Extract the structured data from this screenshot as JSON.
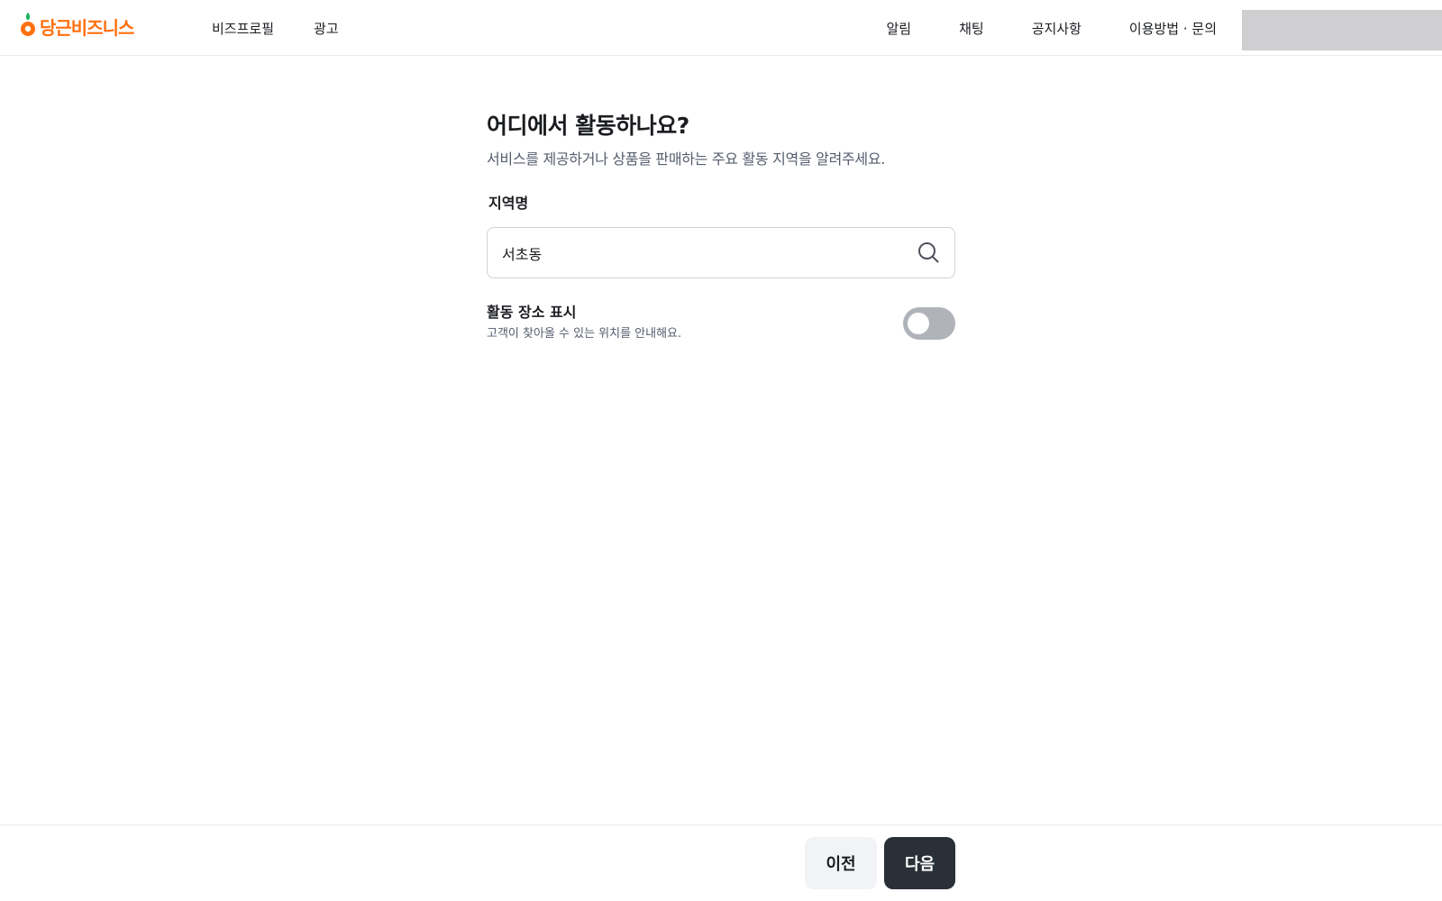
{
  "brand": {
    "name": "당근비즈니스",
    "color": "#ff6f0f",
    "icon": "carrot-icon"
  },
  "nav": {
    "left": [
      {
        "label": "비즈프로필"
      },
      {
        "label": "광고"
      }
    ],
    "right": [
      {
        "label": "알림"
      },
      {
        "label": "채팅"
      },
      {
        "label": "공지사항"
      },
      {
        "label": "이용방법 · 문의"
      }
    ]
  },
  "page": {
    "title": "어디에서 활동하나요?",
    "subtitle": "서비스를 제공하거나 상품을 판매하는 주요 활동 지역을 알려주세요."
  },
  "region": {
    "label": "지역명",
    "value": "서초동",
    "icon": "search-icon"
  },
  "location_toggle": {
    "title": "활동 장소 표시",
    "description": "고객이 찾아올 수 있는 위치를 안내해요.",
    "enabled": false
  },
  "footer": {
    "prev_label": "이전",
    "next_label": "다음"
  },
  "colors": {
    "accent": "#ff6f0f",
    "primary_button": "#2a3038",
    "secondary_button": "#f2f3f6",
    "toggle_off": "#b0b3ba"
  }
}
